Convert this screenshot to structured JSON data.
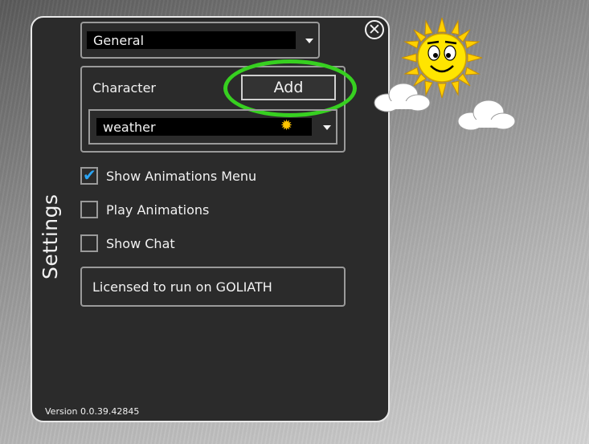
{
  "panel": {
    "title": "Settings",
    "close_icon": "close-icon",
    "version": "Version 0.0.39.42845"
  },
  "general_select": {
    "value": "General"
  },
  "character": {
    "label": "Character",
    "add_label": "Add",
    "selected": "weather",
    "selected_icon": "sun-icon"
  },
  "options": [
    {
      "label": "Show Animations Menu",
      "checked": true
    },
    {
      "label": "Play Animations",
      "checked": false
    },
    {
      "label": "Show Chat",
      "checked": false
    }
  ],
  "license": {
    "text": "Licensed to run on GOLIATH"
  },
  "colors": {
    "panel_bg": "#2b2b2b",
    "highlight": "#37d020",
    "check": "#2aa4f4",
    "sun": "#ffe500"
  }
}
